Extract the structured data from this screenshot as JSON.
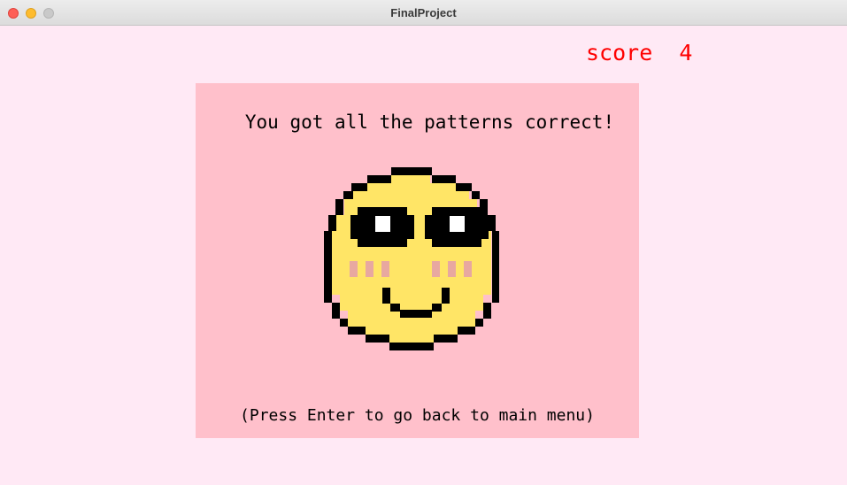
{
  "window": {
    "title": "FinalProject"
  },
  "hud": {
    "score_label": "score  4",
    "score_color": "#ff0000"
  },
  "result_panel": {
    "message": "You got all the patterns correct!",
    "hint": "(Press Enter to go back to main menu)",
    "background": "#ffc0cb"
  },
  "colors": {
    "canvas_background": "#ffe9f5",
    "face": "#ffe566",
    "outline": "#000000",
    "blush": "#e8a8a0",
    "eye_shine": "#ffffff"
  },
  "icons": {
    "smiley": "pixel-smiley-face-icon"
  }
}
